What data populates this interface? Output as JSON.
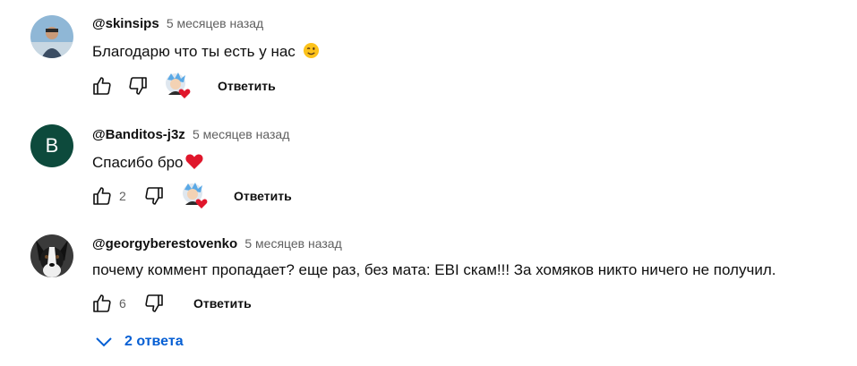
{
  "comments": [
    {
      "author": "@skinsips",
      "time": "5 месяцев назад",
      "text": "Благодарю  что ты есть у нас",
      "emoji": "wink-emoji",
      "likes": "",
      "reply_label": "Ответить"
    },
    {
      "author": "@Banditos-j3z",
      "time": "5 месяцев назад",
      "avatar_letter": "B",
      "text": "Спасибо бро",
      "emoji": "red-heart-emoji",
      "likes": "2",
      "reply_label": "Ответить"
    },
    {
      "author": "@georgyberestovenko",
      "time": "5 месяцев назад",
      "text": "почему коммент пропадает? еще раз, без мата: EBI скам!!! За хомяков никто ничего не получил.",
      "likes": "6",
      "reply_label": "Ответить"
    }
  ],
  "replies_toggle": {
    "label": "2 ответа"
  },
  "colors": {
    "link_blue": "#065fd4",
    "secondary_text": "#606060",
    "avatar_green": "#0d4a3c",
    "heart_red": "#e0162b"
  }
}
